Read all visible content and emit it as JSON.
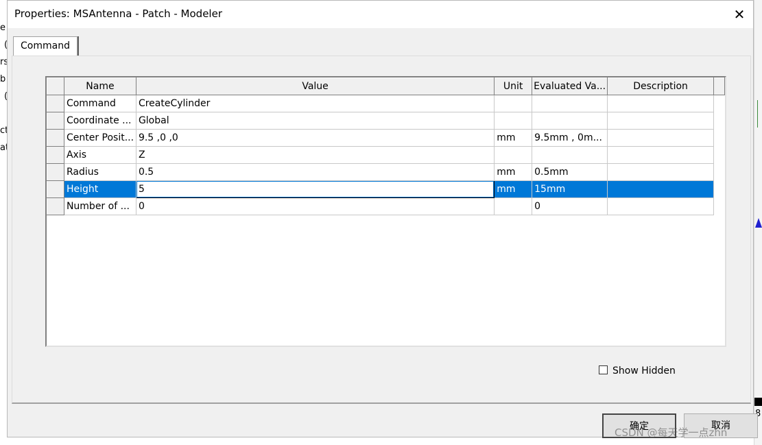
{
  "dialog": {
    "title": "Properties: MSAntenna - Patch - Modeler",
    "close_glyph": "✕",
    "tab_label": "Command"
  },
  "grid": {
    "columns": [
      "Name",
      "Value",
      "Unit",
      "Evaluated Va...",
      "Description"
    ],
    "rows": [
      {
        "name": "Command",
        "value": "CreateCylinder",
        "unit": "",
        "evaluated": "",
        "description": ""
      },
      {
        "name": "Coordinate ...",
        "value": "Global",
        "unit": "",
        "evaluated": "",
        "description": ""
      },
      {
        "name": "Center Posit...",
        "value": "9.5 ,0 ,0",
        "unit": "mm",
        "evaluated": "9.5mm , 0m...",
        "description": ""
      },
      {
        "name": "Axis",
        "value": "Z",
        "unit": "",
        "evaluated": "",
        "description": ""
      },
      {
        "name": "Radius",
        "value": "0.5",
        "unit": "mm",
        "evaluated": "0.5mm",
        "description": ""
      },
      {
        "name": "Height",
        "value": "5",
        "unit": "mm",
        "evaluated": "15mm",
        "description": ""
      },
      {
        "name": "Number of ...",
        "value": "0",
        "unit": "",
        "evaluated": "0",
        "description": ""
      }
    ],
    "selected_row_index": 5
  },
  "options": {
    "show_hidden_label": "Show Hidden",
    "show_hidden_checked": false
  },
  "buttons": {
    "ok_label": "确定",
    "cancel_label": "取消"
  },
  "background": {
    "left_letters": [
      "e",
      "(",
      "rs",
      "b",
      "(",
      "ct",
      "at"
    ],
    "right_label": "8"
  },
  "watermark": "CSDN @每天学一点zhn",
  "colors": {
    "selection": "#0078d7",
    "dialog_bg": "#f0f0f0"
  }
}
